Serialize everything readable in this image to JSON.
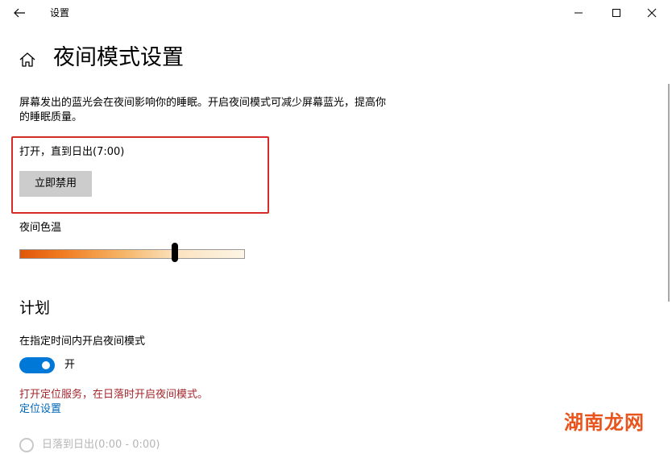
{
  "app": {
    "title": "设置"
  },
  "page": {
    "title": "夜间模式设置"
  },
  "night_light": {
    "description": "屏幕发出的蓝光会在夜间影响你的睡眠。开启夜间模式可减少屏幕蓝光，提高你的睡眠质量。",
    "status": "打开，直到日出(7:00)",
    "disable_button": "立即禁用",
    "strength_label": "夜间色温",
    "strength_value": 0.69
  },
  "schedule": {
    "heading": "计划",
    "toggle_label": "在指定时间内开启夜间模式",
    "toggle_state": "开",
    "toggle_on": true,
    "warning": "打开定位服务，在日落时开启夜间模式。",
    "location_link": "定位设置",
    "option_sunset": "日落到日出(0:00 - 0:00)"
  },
  "watermark": {
    "text": "湖南龙网"
  },
  "colors": {
    "accent": "#0078d7",
    "warning": "#a4262c",
    "link": "#0067b8",
    "highlight_border": "#d62b2b"
  }
}
